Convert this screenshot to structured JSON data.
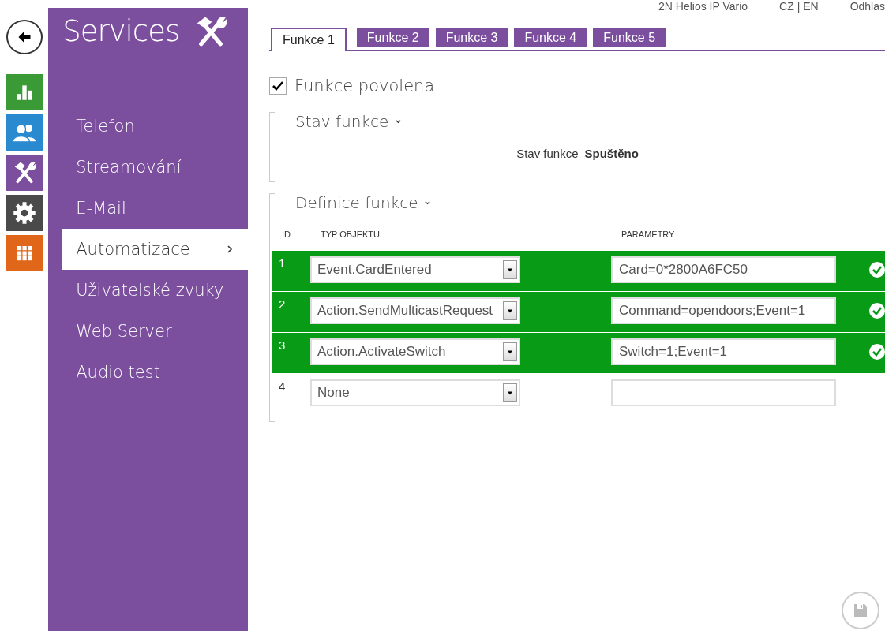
{
  "top_bar": {
    "device": "2N Helios IP Vario",
    "language": "CZ | EN",
    "logout": "Odhlas"
  },
  "app_nav": [
    {
      "kind": "back"
    },
    {
      "kind": "status"
    },
    {
      "kind": "directory"
    },
    {
      "kind": "services"
    },
    {
      "kind": "hardware"
    },
    {
      "kind": "system"
    }
  ],
  "sidebar": {
    "title": "Services",
    "items": [
      {
        "label": "Telefon",
        "selected": false
      },
      {
        "label": "Streamování",
        "selected": false
      },
      {
        "label": "E-Mail",
        "selected": false
      },
      {
        "label": "Automatizace",
        "selected": true
      },
      {
        "label": "Uživatelské zvuky",
        "selected": false
      },
      {
        "label": "Web Server",
        "selected": false
      },
      {
        "label": "Audio test",
        "selected": false
      }
    ]
  },
  "tabs": [
    {
      "label": "Funkce 1",
      "selected": true
    },
    {
      "label": "Funkce 2",
      "selected": false
    },
    {
      "label": "Funkce 3",
      "selected": false
    },
    {
      "label": "Funkce 4",
      "selected": false
    },
    {
      "label": "Funkce 5",
      "selected": false
    }
  ],
  "enabled": {
    "label": "Funkce povolena",
    "checked": true
  },
  "status_section": {
    "title": "Stav funkce",
    "expanded": true,
    "label": "Stav funkce",
    "value": "Spuštěno"
  },
  "definition_section": {
    "title": "Definice funkce",
    "expanded": true,
    "columns": [
      "ID",
      "TYP OBJEKTU",
      "PARAMETRY"
    ],
    "rows": [
      {
        "id": "1",
        "type": "Event.CardEntered",
        "parameters": "Card=0*2800A6FC50",
        "valid": true
      },
      {
        "id": "2",
        "type": "Action.SendMulticastRequest",
        "parameters": "Command=opendoors;Event=1",
        "valid": true
      },
      {
        "id": "3",
        "type": "Action.ActivateSwitch",
        "parameters": "Switch=1;Event=1",
        "valid": true
      },
      {
        "id": "4",
        "type": "None",
        "parameters": "",
        "valid": false
      }
    ]
  }
}
